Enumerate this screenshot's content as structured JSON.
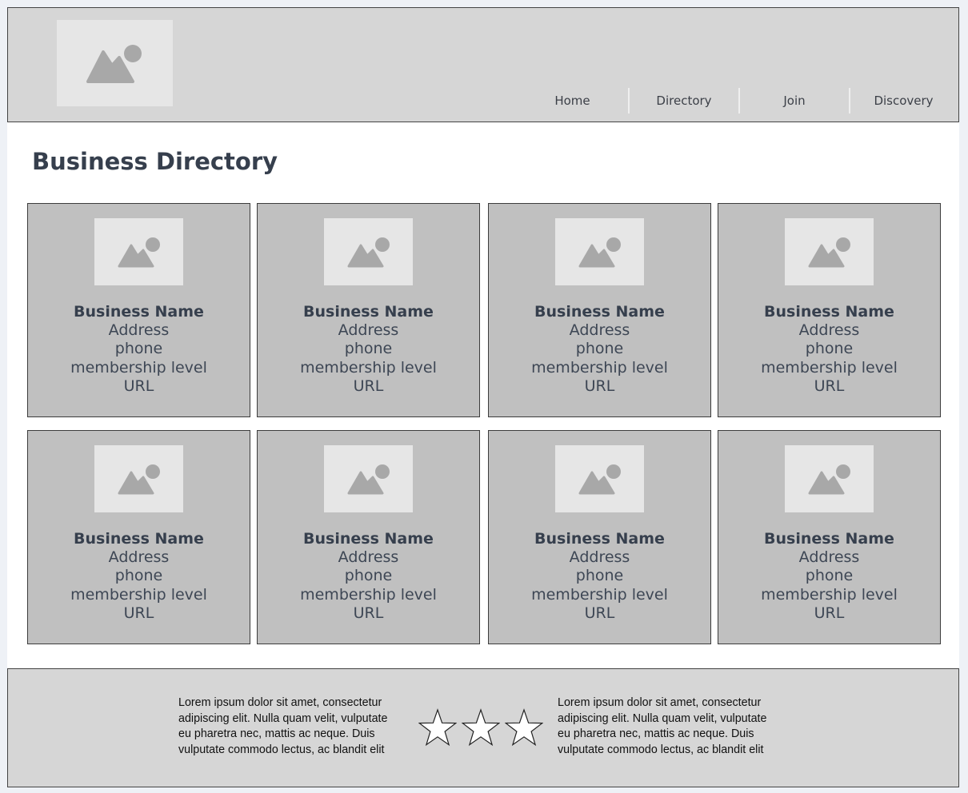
{
  "header": {
    "logo_icon": "image-placeholder-icon",
    "nav": [
      "Home",
      "Directory",
      "Join",
      "Discovery"
    ]
  },
  "main": {
    "title": "Business Directory",
    "cards": [
      {
        "name": "Business Name",
        "address": "Address",
        "phone": "phone",
        "membership": "membership level",
        "url": "URL"
      },
      {
        "name": "Business Name",
        "address": "Address",
        "phone": "phone",
        "membership": "membership level",
        "url": "URL"
      },
      {
        "name": "Business Name",
        "address": "Address",
        "phone": "phone",
        "membership": "membership level",
        "url": "URL"
      },
      {
        "name": "Business Name",
        "address": "Address",
        "phone": "phone",
        "membership": "membership level",
        "url": "URL"
      },
      {
        "name": "Business Name",
        "address": "Address",
        "phone": "phone",
        "membership": "membership level",
        "url": "URL"
      },
      {
        "name": "Business Name",
        "address": "Address",
        "phone": "phone",
        "membership": "membership level",
        "url": "URL"
      },
      {
        "name": "Business Name",
        "address": "Address",
        "phone": "phone",
        "membership": "membership level",
        "url": "URL"
      },
      {
        "name": "Business Name",
        "address": "Address",
        "phone": "phone",
        "membership": "membership level",
        "url": "URL"
      }
    ]
  },
  "footer": {
    "left_lines": [
      "Lorem ipsum dolor sit amet, consectetur",
      "adipiscing elit. Nulla quam velit, vulputate",
      "eu pharetra nec, mattis ac neque. Duis",
      "vulputate commodo lectus, ac blandit elit"
    ],
    "right_lines": [
      "Lorem ipsum dolor sit amet, consectetur",
      "adipiscing elit. Nulla quam velit, vulputate",
      "eu pharetra nec, mattis ac neque. Duis",
      "vulputate commodo lectus, ac blandit elit"
    ],
    "star_icons": [
      "star-outline-icon",
      "star-outline-icon",
      "star-outline-icon"
    ]
  },
  "colors": {
    "header_bg": "#d6d6d6",
    "card_bg": "#c0c0c0",
    "placeholder_bg": "#e6e6e6",
    "placeholder_icon": "#a8a8a8",
    "title_text": "#363f4d"
  }
}
